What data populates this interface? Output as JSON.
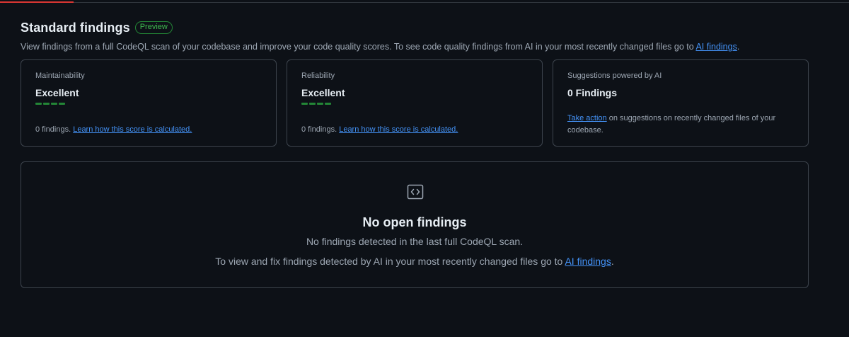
{
  "header": {
    "title": "Standard findings",
    "badge": "Preview",
    "description_prefix": "View findings from a full CodeQL scan of your codebase and improve your code quality scores. To see code quality findings from AI in your most recently changed files go to ",
    "description_link": "AI findings",
    "description_suffix": "."
  },
  "cards": [
    {
      "label": "Maintainability",
      "value": "Excellent",
      "score_level": 4,
      "score_max": 4,
      "findings_text": "0 findings. ",
      "link_text": "Learn how this score is calculated."
    },
    {
      "label": "Reliability",
      "value": "Excellent",
      "score_level": 4,
      "score_max": 4,
      "findings_text": "0 findings. ",
      "link_text": "Learn how this score is calculated."
    },
    {
      "label": "Suggestions powered by AI",
      "value": "0 Findings",
      "action_link": "Take action",
      "action_text": " on suggestions on recently changed files of your codebase."
    }
  ],
  "empty_state": {
    "icon": "code-icon",
    "title": "No open findings",
    "line1": "No findings detected in the last full CodeQL scan.",
    "line2_prefix": "To view and fix findings detected by AI in your most recently changed files go to ",
    "line2_link": "AI findings",
    "line2_suffix": "."
  },
  "colors": {
    "background": "#0d1117",
    "border": "#3d444d",
    "link": "#4493f8",
    "success": "#238636",
    "badge_text": "#3fb950",
    "accent_top": "#da3633"
  }
}
